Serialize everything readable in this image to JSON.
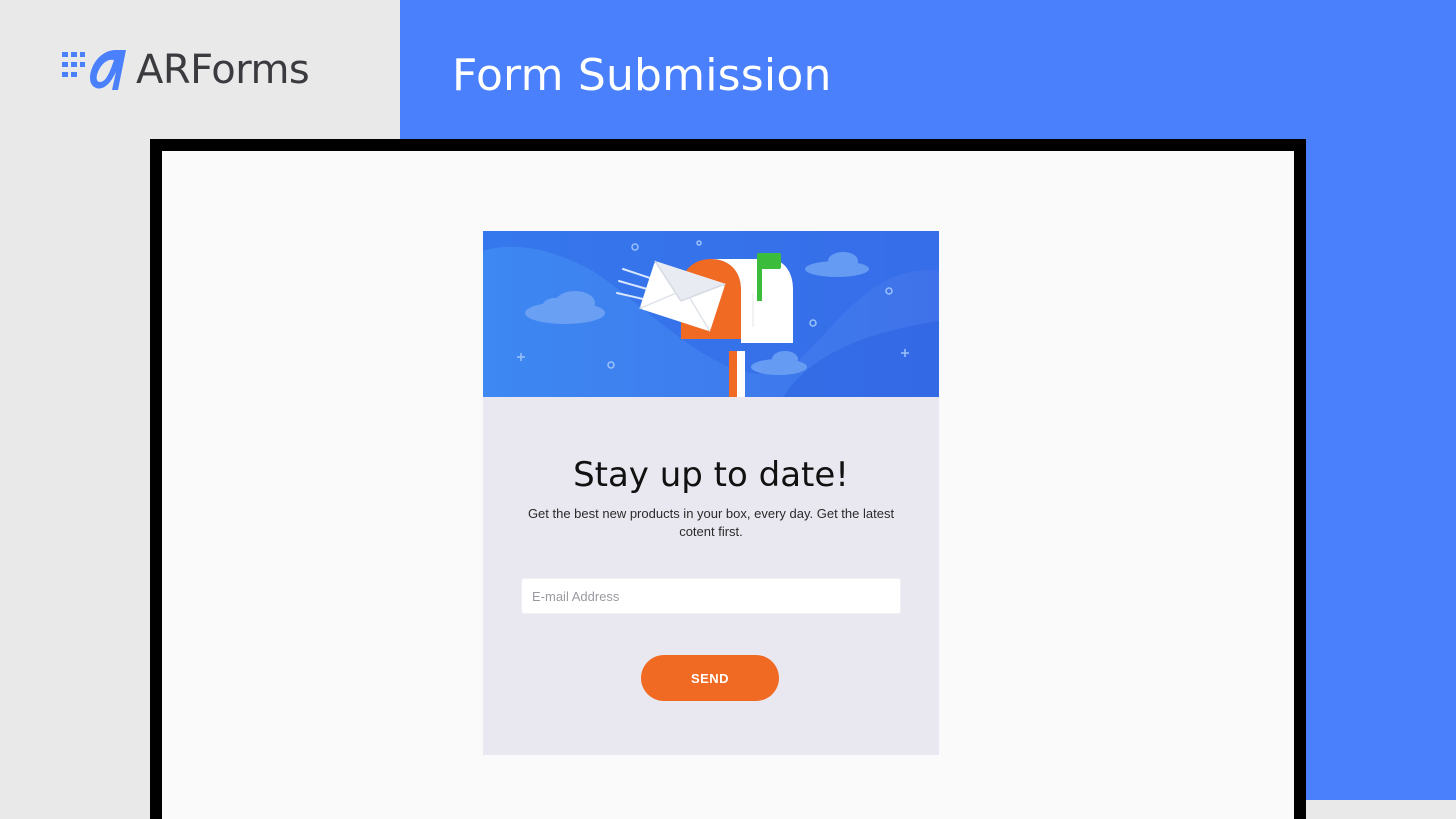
{
  "brand": {
    "name": "ARForms",
    "accent_color": "#4b80fd",
    "logo_icon": "arforms-logo-icon"
  },
  "header": {
    "title": "Form Submission"
  },
  "form": {
    "hero_image": "mailbox-illustration",
    "headline": "Stay up to date!",
    "subtext": "Get the best new products in your box, every day. Get the latest cotent first.",
    "email": {
      "value": "",
      "placeholder": "E-mail Address"
    },
    "submit_label": "SEND",
    "button_color": "#f06a23"
  }
}
